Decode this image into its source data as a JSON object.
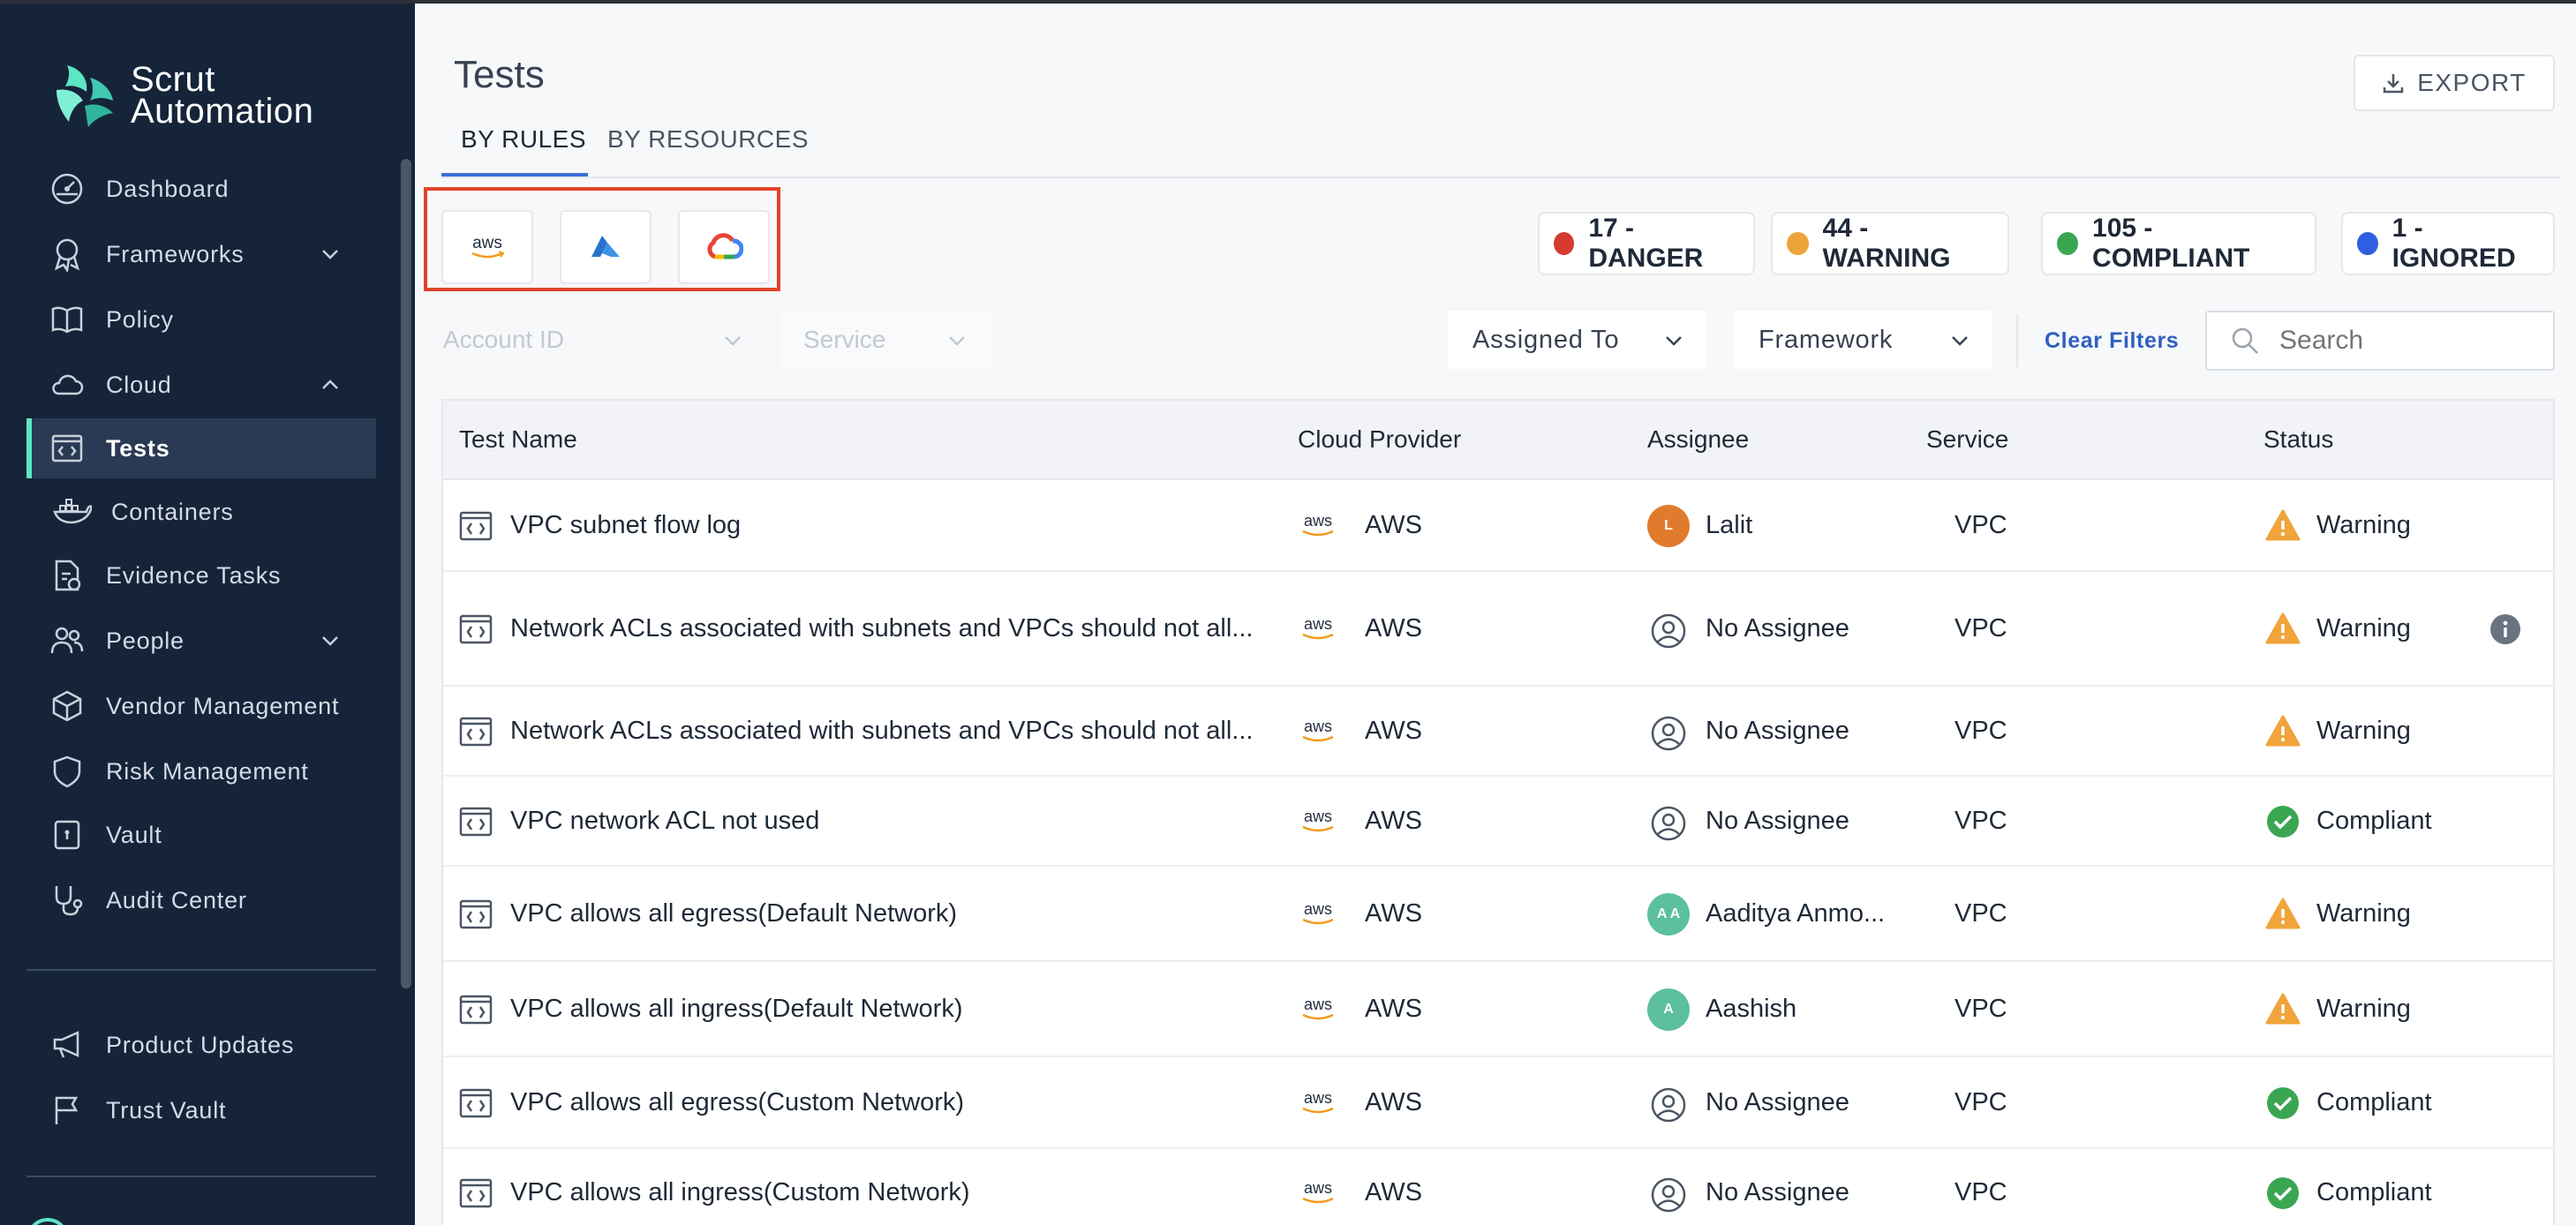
{
  "app": {
    "logo_line1": "Scrut",
    "logo_line2": "Automation"
  },
  "sidebar": {
    "items": [
      {
        "label": "Dashboard",
        "icon": "dashboard-icon"
      },
      {
        "label": "Frameworks",
        "icon": "award-icon",
        "chevron": "down"
      },
      {
        "label": "Policy",
        "icon": "book-icon"
      },
      {
        "label": "Cloud",
        "icon": "cloud-icon",
        "chevron": "up"
      },
      {
        "label": "Tests",
        "icon": "code-window-icon",
        "active": true
      },
      {
        "label": "Containers",
        "icon": "docker-icon"
      },
      {
        "label": "Evidence Tasks",
        "icon": "evidence-icon"
      },
      {
        "label": "People",
        "icon": "people-icon",
        "chevron": "down"
      },
      {
        "label": "Vendor Management",
        "icon": "box-icon"
      },
      {
        "label": "Risk Management",
        "icon": "shield-icon"
      },
      {
        "label": "Vault",
        "icon": "vault-icon"
      },
      {
        "label": "Audit Center",
        "icon": "stethoscope-icon"
      },
      {
        "label": "Product Updates",
        "icon": "megaphone-icon"
      },
      {
        "label": "Trust Vault",
        "icon": "flag-icon"
      }
    ]
  },
  "page": {
    "title": "Tests",
    "export_label": "EXPORT",
    "tabs": [
      "BY RULES",
      "BY RESOURCES"
    ]
  },
  "providers": [
    "aws",
    "azure",
    "gcp"
  ],
  "status_summary": [
    {
      "label": "17 - DANGER",
      "color": "#d63a2f"
    },
    {
      "label": "44 - WARNING",
      "color": "#eca43a"
    },
    {
      "label": "105 - COMPLIANT",
      "color": "#3aa652"
    },
    {
      "label": "1 - IGNORED",
      "color": "#2f5fe0"
    }
  ],
  "filters": {
    "account_id": "Account ID",
    "service": "Service",
    "assigned_to": "Assigned To",
    "framework": "Framework",
    "clear": "Clear Filters",
    "search_placeholder": "Search"
  },
  "table": {
    "columns": [
      "Test Name",
      "Cloud Provider",
      "Assignee",
      "Service",
      "Status"
    ],
    "rows": [
      {
        "name": "VPC subnet flow log",
        "provider": "AWS",
        "assignee": "Lalit",
        "avatar": "L",
        "avatar_color": "#e07b2e",
        "service": "VPC",
        "status": "Warning"
      },
      {
        "name": "Network ACLs associated with subnets and VPCs should not all...",
        "provider": "AWS",
        "assignee": "No Assignee",
        "avatar": "",
        "service": "VPC",
        "status": "Warning",
        "info": true
      },
      {
        "name": "Network ACLs associated with subnets and VPCs should not all...",
        "provider": "AWS",
        "assignee": "No Assignee",
        "avatar": "",
        "service": "VPC",
        "status": "Warning"
      },
      {
        "name": "VPC network ACL not used",
        "provider": "AWS",
        "assignee": "No Assignee",
        "avatar": "",
        "service": "VPC",
        "status": "Compliant"
      },
      {
        "name": "VPC allows all egress(Default Network)",
        "provider": "AWS",
        "assignee": "Aaditya Anmo...",
        "avatar": "A A",
        "avatar_color": "#5bbfa0",
        "service": "VPC",
        "status": "Warning"
      },
      {
        "name": "VPC allows all ingress(Default Network)",
        "provider": "AWS",
        "assignee": "Aashish",
        "avatar": "A",
        "avatar_color": "#5bbfa0",
        "service": "VPC",
        "status": "Warning"
      },
      {
        "name": "VPC allows all egress(Custom Network)",
        "provider": "AWS",
        "assignee": "No Assignee",
        "avatar": "",
        "service": "VPC",
        "status": "Compliant"
      },
      {
        "name": "VPC allows all ingress(Custom Network)",
        "provider": "AWS",
        "assignee": "No Assignee",
        "avatar": "",
        "service": "VPC",
        "status": "Compliant"
      }
    ]
  }
}
